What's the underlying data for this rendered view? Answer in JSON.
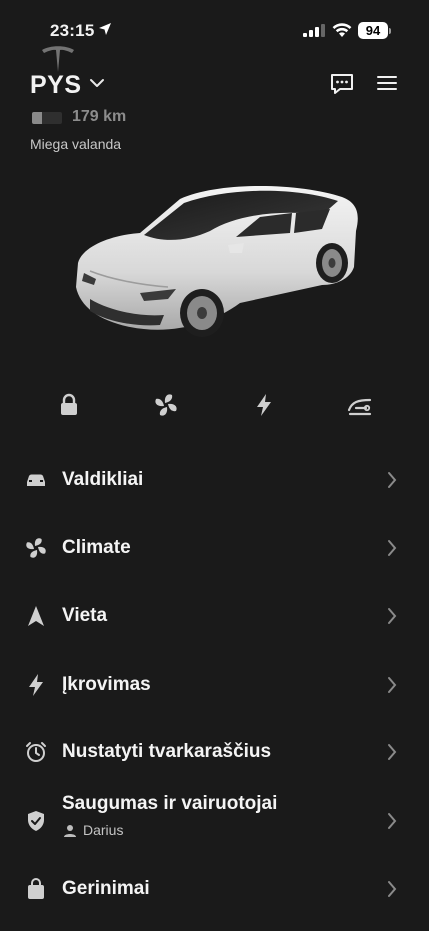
{
  "status_bar": {
    "time": "23:15",
    "battery": "94"
  },
  "header": {
    "car_name": "PYS",
    "range": "179 km",
    "status": "Miega valanda"
  },
  "quick_actions": [
    "lock-icon",
    "fan-icon",
    "bolt-icon",
    "frunk-icon"
  ],
  "menu": {
    "items": [
      {
        "label": "Valdikliai",
        "icon": "car-icon"
      },
      {
        "label": "Climate",
        "icon": "fan-icon"
      },
      {
        "label": "Vieta",
        "icon": "location-arrow-icon"
      },
      {
        "label": "Įkrovimas",
        "icon": "bolt-icon"
      },
      {
        "label": "Nustatyti tvarkaraščius",
        "icon": "alarm-clock-icon"
      },
      {
        "label": "Saugumas ir vairuotojai",
        "sub": "Darius",
        "icon": "shield-check-icon"
      },
      {
        "label": "Gerinimai",
        "icon": "bag-icon"
      }
    ]
  }
}
